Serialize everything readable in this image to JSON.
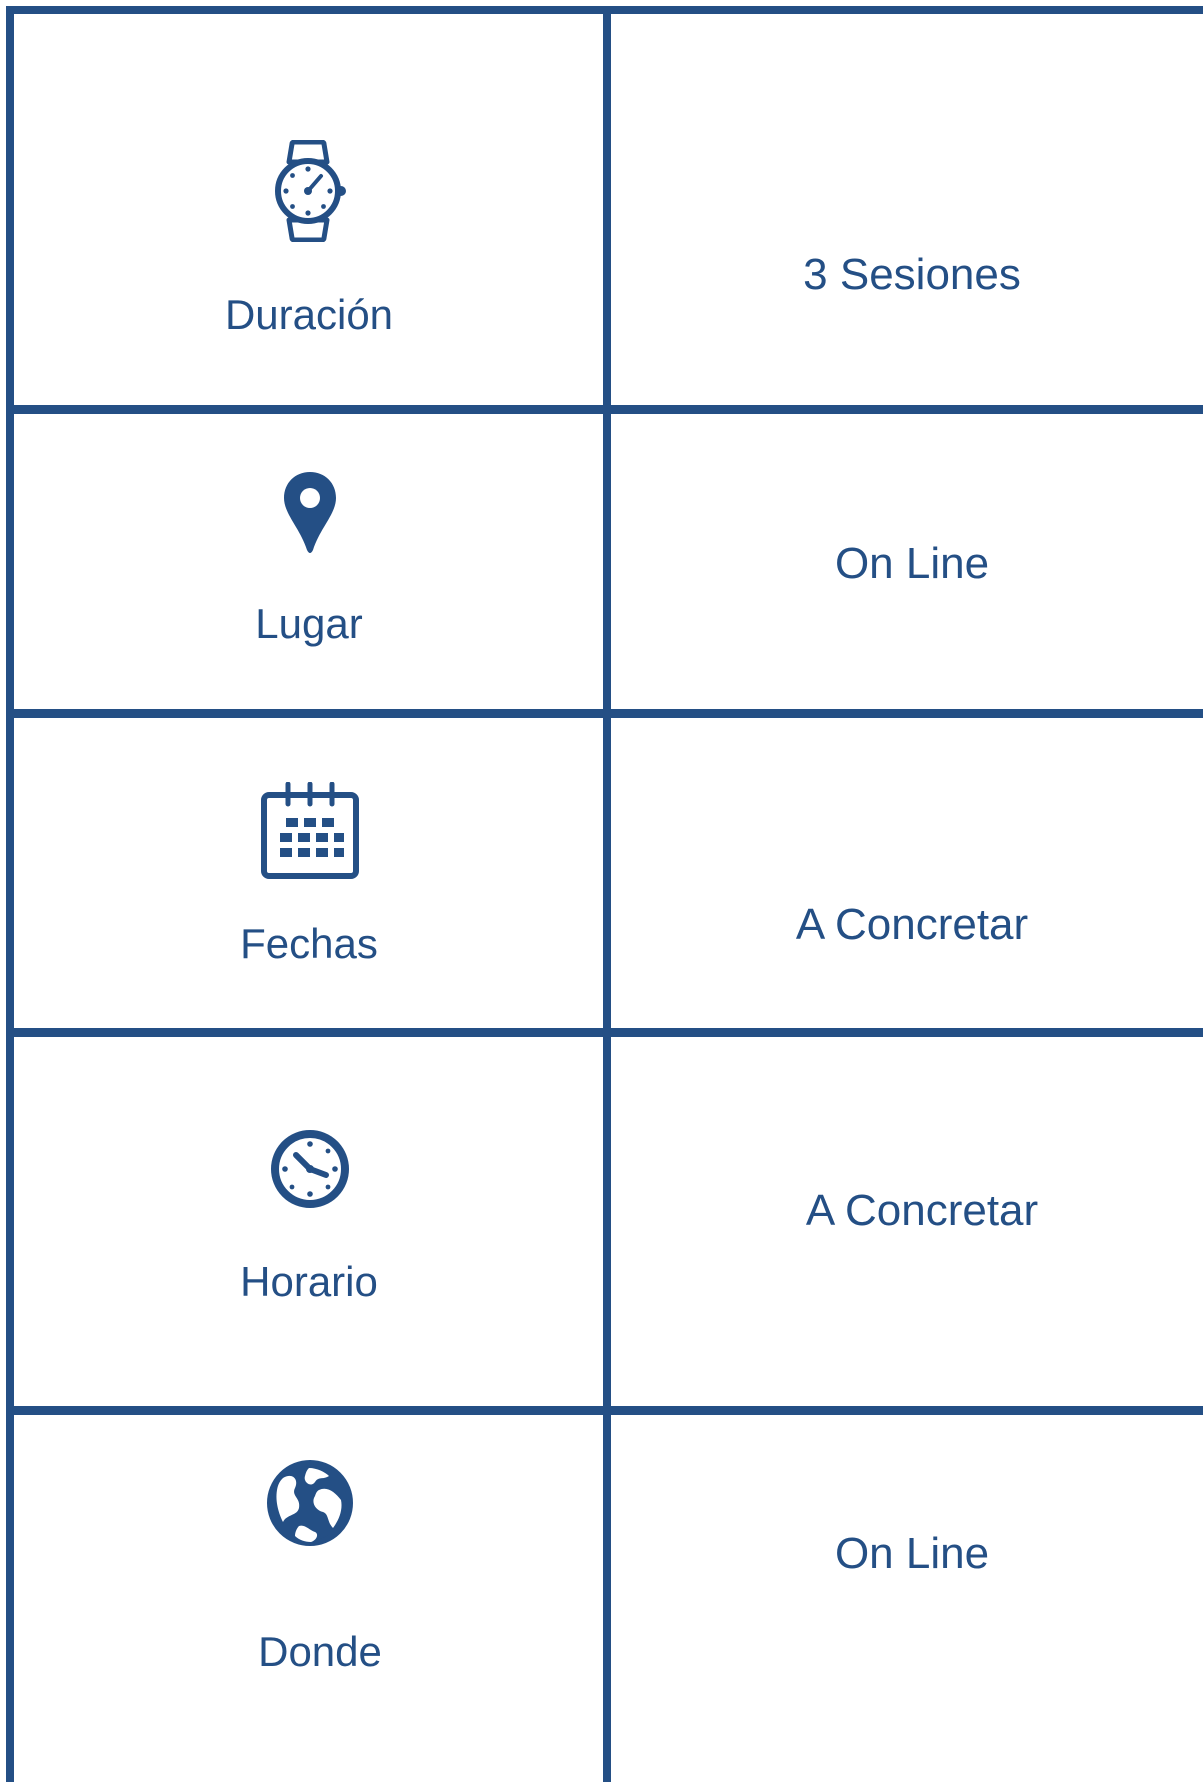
{
  "colors": {
    "border": "#244f85",
    "text": "#244f85",
    "background": "#ffffff"
  },
  "rows": [
    {
      "label": "Duración",
      "value": "3 Sesiones",
      "icon": "wristwatch-icon"
    },
    {
      "label": "Lugar",
      "value": "On Line",
      "icon": "map-pin-icon"
    },
    {
      "label": "Fechas",
      "value": "A Concretar",
      "icon": "calendar-icon"
    },
    {
      "label": "Horario",
      "value": "A Concretar",
      "icon": "clock-icon"
    },
    {
      "label": "Donde",
      "value": "On Line",
      "icon": "globe-icon"
    }
  ]
}
